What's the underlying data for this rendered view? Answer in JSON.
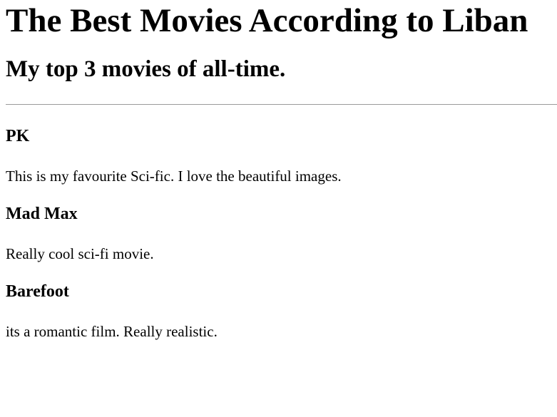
{
  "page": {
    "title": "The Best Movies According to Liban",
    "subtitle": "My top 3 movies of all-time."
  },
  "movies": [
    {
      "title": "PK",
      "description": "This is my favourite Sci-fic. I love the beautiful images."
    },
    {
      "title": "Mad Max",
      "description": "Really cool sci-fi movie."
    },
    {
      "title": "Barefoot",
      "description": "its a romantic film. Really realistic."
    }
  ]
}
